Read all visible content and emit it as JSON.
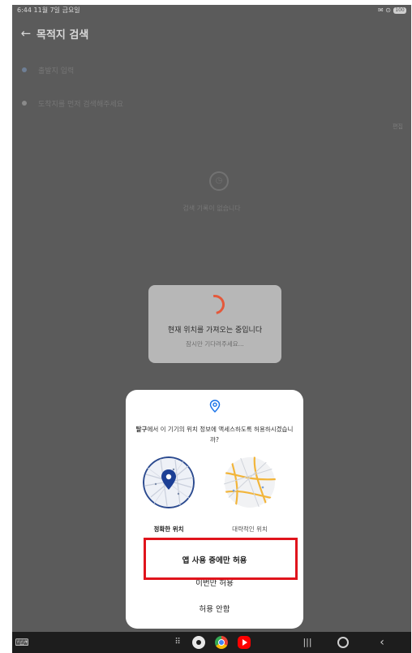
{
  "status_bar": {
    "time": "6:44  11월 7일 금요일",
    "icons": "✉ ⊙",
    "battery": "100"
  },
  "header": {
    "title": "목적지 검색"
  },
  "route": {
    "origin_placeholder": "출발지 입력",
    "destination_placeholder": "도착지를 먼저 검색해주세요"
  },
  "history": {
    "edit_label": "편집",
    "empty_message": "검색 기록이 없습니다"
  },
  "loading": {
    "title": "현재 위치를 가져오는 중입니다",
    "subtitle": "잠시만 기다려주세요..."
  },
  "permission_dialog": {
    "app_name": "탈구",
    "question": "에서 이 기기의 위치 정보에 액세스하도록 허용하시겠습니까?",
    "precise_label": "정확한 위치",
    "approximate_label": "대략적인 위치",
    "allow_while_using": "앱 사용 중에만 허용",
    "allow_once": "이번만 허용",
    "deny": "허용 안함"
  },
  "colors": {
    "dim_background": "#5b5b5b",
    "loading_card": "#b7b7b7",
    "spinner": "#e4593b",
    "highlight_box": "#e0141c",
    "pin": "#1a73e8"
  },
  "nav_bar": {
    "icons": [
      "keyboard-icon",
      "apps-grid-icon",
      "settings-app-icon",
      "chrome-app-icon",
      "youtube-app-icon",
      "recents-icon",
      "home-icon",
      "back-icon"
    ]
  }
}
